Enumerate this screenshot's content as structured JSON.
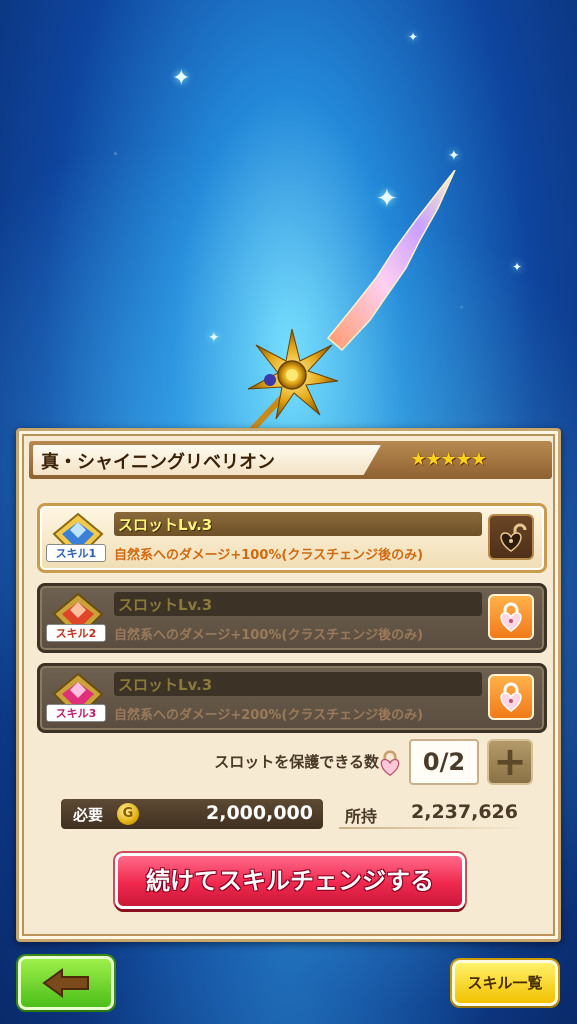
{
  "item": {
    "name": "真・シャイニングリベリオン",
    "rarity_stars": "★★★★★",
    "rarity_count": 5
  },
  "slots": [
    {
      "badge": "スキル1",
      "title": "スロットLv.3",
      "desc": "自然系へのダメージ+100%(クラスチェンジ後のみ)",
      "state": "unlocked",
      "color": "#3a7fd8"
    },
    {
      "badge": "スキル2",
      "title": "スロットLv.3",
      "desc": "自然系へのダメージ+100%(クラスチェンジ後のみ)",
      "state": "locked",
      "color": "#e0452a"
    },
    {
      "badge": "スキル3",
      "title": "スロットLv.3",
      "desc": "自然系へのダメージ+200%(クラスチェンジ後のみ)",
      "state": "locked",
      "color": "#e0307a"
    }
  ],
  "protect": {
    "label": "スロットを保護できる数",
    "value": "0/2"
  },
  "cost": {
    "label": "必要",
    "coin_symbol": "G",
    "value": "2,000,000"
  },
  "owned": {
    "label": "所持",
    "value": "2,237,626"
  },
  "buttons": {
    "continue": "続けてスキルチェンジする",
    "skill_list": "スキル一覧"
  },
  "icons": {
    "back": "arrow-left-icon",
    "plus": "plus-icon",
    "lock_open": "unlocked-heart-lock-icon",
    "lock_closed": "locked-heart-lock-icon",
    "coin": "gold-coin-icon"
  }
}
